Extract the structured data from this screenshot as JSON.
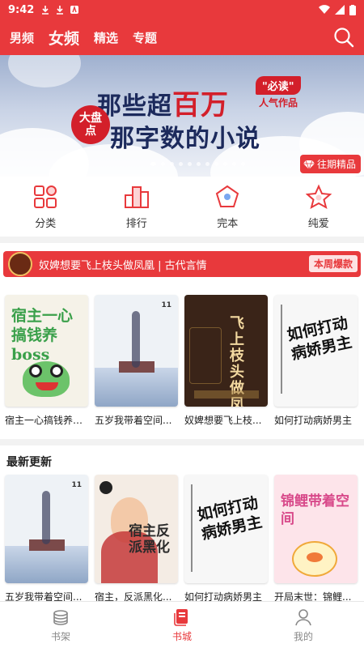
{
  "status": {
    "time": "9:42"
  },
  "header": {
    "tabs": [
      {
        "label": "男频"
      },
      {
        "label": "女频"
      },
      {
        "label": "精选"
      },
      {
        "label": "专题"
      }
    ],
    "active_tab": "女频"
  },
  "banner": {
    "line1_a": "那些超",
    "line1_b": "百万",
    "line2": "那字数的小说",
    "circle": "大盘点",
    "must": "\"必读\"",
    "popular": "人气作品",
    "past_label": "往期精品"
  },
  "quick": [
    {
      "label": "分类",
      "icon": "grid-icon"
    },
    {
      "label": "排行",
      "icon": "rank-icon"
    },
    {
      "label": "完本",
      "icon": "pentagon-icon"
    },
    {
      "label": "纯爱",
      "icon": "star-icon"
    }
  ],
  "hot": {
    "title": "奴婢想要飞上枝头做凤凰 | 古代言情",
    "tag": "本周爆款"
  },
  "row1": {
    "books": [
      {
        "title": "宿主一心搞钱养b..."
      },
      {
        "title": "五岁我带着空间..."
      },
      {
        "title": "奴婢想要飞上枝..."
      },
      {
        "title": "如何打动病娇男主"
      }
    ],
    "cover_texts": [
      "宿主一心搞钱养boss",
      "",
      "飞上枝头做凤凰",
      "如何打动病娇男主"
    ]
  },
  "latest": {
    "title": "最新更新",
    "books": [
      {
        "title": "五岁我带着空间..."
      },
      {
        "title": "宿主，反派黑化..."
      },
      {
        "title": "如何打动病娇男主"
      },
      {
        "title": "开局末世：锦鲤..."
      }
    ],
    "cover_texts": [
      "",
      "宿主反派黑化",
      "如何打动病娇男主",
      "锦鲤带着空间"
    ]
  },
  "bottom_nav": [
    {
      "label": "书架",
      "icon": "bookshelf-icon"
    },
    {
      "label": "书城",
      "icon": "bookstore-icon"
    },
    {
      "label": "我的",
      "icon": "profile-icon"
    }
  ],
  "colors": {
    "brand": "#e8393c",
    "inactive": "#888888"
  }
}
